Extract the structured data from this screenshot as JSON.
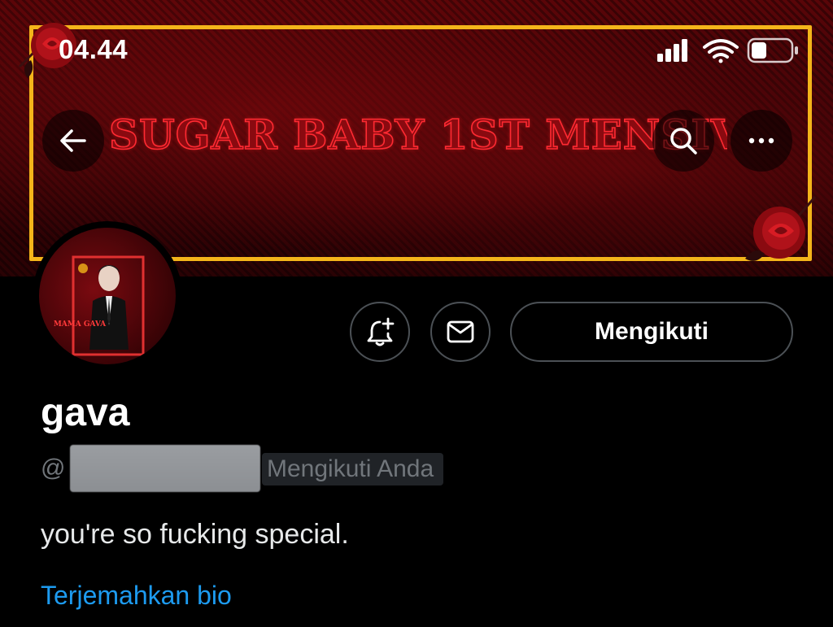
{
  "status_bar": {
    "time": "04.44",
    "icons": [
      "signal-icon",
      "wifi-icon",
      "battery-icon"
    ]
  },
  "banner": {
    "headline": "SUGAR BABY 1ST MENSIVE",
    "frame_color": "#f4b51a",
    "headline_color": "#ff2a32"
  },
  "header": {
    "back_icon": "back-arrow-icon",
    "search_icon": "search-icon",
    "more_icon": "more-icon"
  },
  "avatar": {
    "caption": "MAMA GAVA"
  },
  "actions": {
    "notify_icon": "bell-plus-icon",
    "message_icon": "mail-icon",
    "following_label": "Mengikuti"
  },
  "profile": {
    "display_name": "gava",
    "handle_prefix": "@",
    "follows_you_badge": "Mengikuti Anda",
    "bio": "you're so fucking special.",
    "translate_link": "Terjemahkan bio"
  },
  "colors": {
    "background": "#000000",
    "accent_link": "#1d9bf0",
    "muted_text": "#71767b",
    "button_border": "#4b5055"
  }
}
